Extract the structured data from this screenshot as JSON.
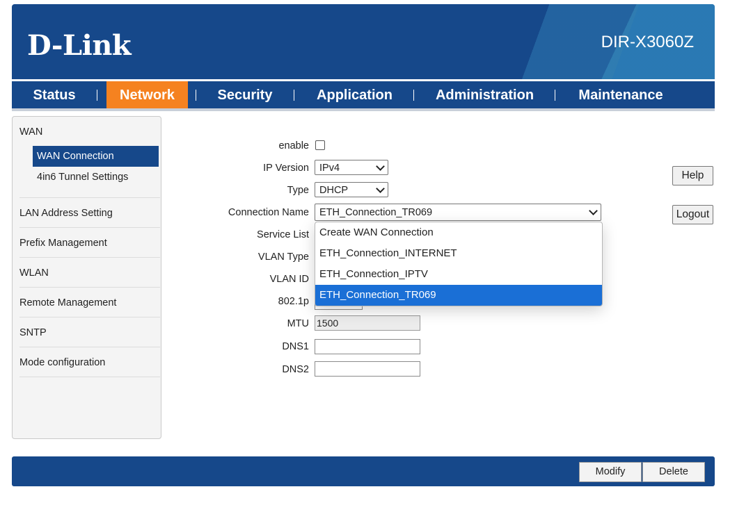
{
  "header": {
    "logo": "D-Link",
    "model": "DIR-X3060Z"
  },
  "nav": {
    "items": [
      {
        "label": "Status"
      },
      {
        "label": "Network"
      },
      {
        "label": "Security"
      },
      {
        "label": "Application"
      },
      {
        "label": "Administration"
      },
      {
        "label": "Maintenance"
      }
    ],
    "active": "Network",
    "active_color": "#f58220",
    "bar_color": "#16488a"
  },
  "sidebar": {
    "sections": [
      {
        "label": "WAN",
        "children": [
          {
            "label": "WAN Connection",
            "active": true
          },
          {
            "label": "4in6 Tunnel Settings"
          }
        ]
      },
      {
        "label": "LAN Address Setting"
      },
      {
        "label": "Prefix Management"
      },
      {
        "label": "WLAN"
      },
      {
        "label": "Remote Management"
      },
      {
        "label": "SNTP"
      },
      {
        "label": "Mode configuration"
      }
    ]
  },
  "form": {
    "enable_label": "enable",
    "enable_checked": false,
    "ip_version_label": "IP Version",
    "ip_version_value": "IPv4",
    "type_label": "Type",
    "type_value": "DHCP",
    "connection_name_label": "Connection Name",
    "connection_name_value": "ETH_Connection_TR069",
    "service_list_label": "Service List",
    "vlan_type_label": "VLAN Type",
    "vlan_id_label": "VLAN ID",
    "p8021_label": "802.1p",
    "mtu_label": "MTU",
    "mtu_value": "1500",
    "dns1_label": "DNS1",
    "dns1_value": "",
    "dns2_label": "DNS2",
    "dns2_value": ""
  },
  "dropdown": {
    "options": [
      "Create WAN Connection",
      "ETH_Connection_INTERNET",
      "ETH_Connection_IPTV",
      "ETH_Connection_TR069"
    ],
    "selected": "ETH_Connection_TR069",
    "highlight_color": "#1a6fd6"
  },
  "side_buttons": {
    "help": "Help",
    "logout": "Logout"
  },
  "footer": {
    "modify": "Modify",
    "delete": "Delete"
  }
}
